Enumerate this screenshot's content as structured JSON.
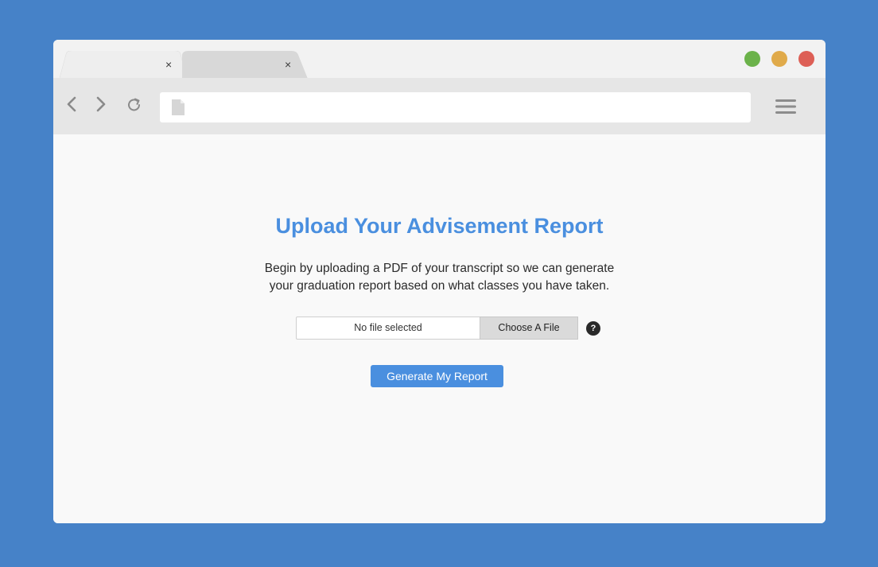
{
  "browser": {
    "tabs": [
      {
        "close_label": "×",
        "active": true
      },
      {
        "close_label": "×",
        "active": false
      }
    ],
    "window_controls": [
      {
        "name": "green-dot",
        "color": "#6bb24a"
      },
      {
        "name": "yellow-dot",
        "color": "#e0aa4a"
      },
      {
        "name": "red-dot",
        "color": "#dd5f56"
      }
    ],
    "nav_icons": [
      "back-icon",
      "forward-icon",
      "reload-icon"
    ],
    "address_icon": "document-icon",
    "menu_icon": "hamburger-menu-icon"
  },
  "page": {
    "title": "Upload Your Advisement Report",
    "description_line1": "Begin by uploading a PDF of your transcript so we can generate",
    "description_line2": "your graduation report based on what classes you have taken.",
    "file_input": {
      "status": "No file selected",
      "button_label": "Choose A File",
      "help_label": "?"
    },
    "generate_button": "Generate My Report",
    "accent_color": "#4a8fdf"
  }
}
